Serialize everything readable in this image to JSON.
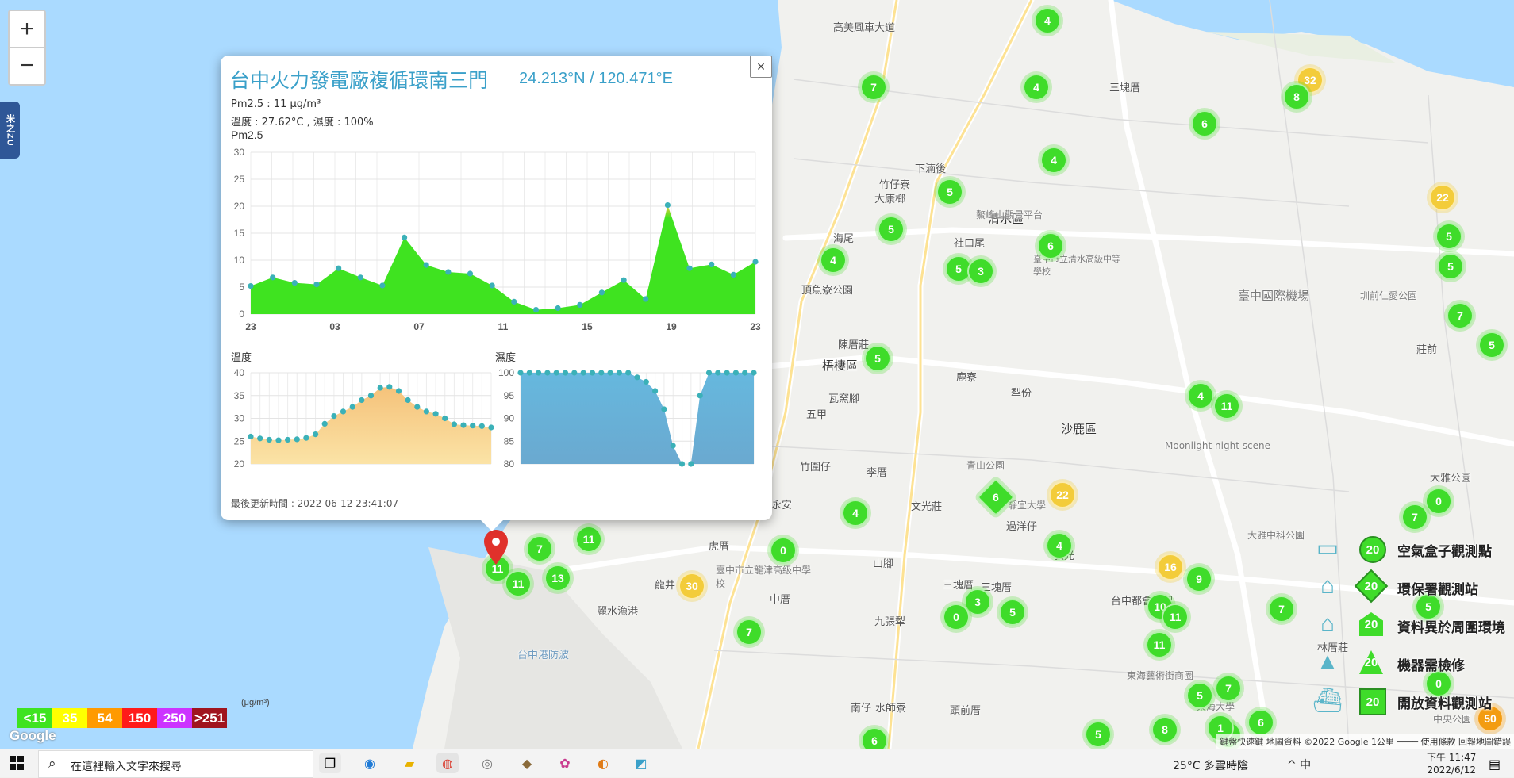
{
  "zoom": {
    "in_label": "+",
    "out_label": "−"
  },
  "side_tab": {
    "label": "米之ZU"
  },
  "popup": {
    "title": "台中火力發電廠複循環南三門",
    "coords": "24.213°N / 120.471°E",
    "pm_line": "Pm2.5 : 11 μg/m³",
    "temp_hum_line": "溫度 : 27.62°C , 濕度 : 100%",
    "chart_title": "Pm2.5",
    "temp_title": "溫度",
    "hum_title": "濕度",
    "updated": "最後更新時間 : 2022-06-12 23:41:07",
    "close_label": "×"
  },
  "chart_data": [
    {
      "type": "area",
      "title": "Pm2.5",
      "x": [
        "23",
        "00",
        "01",
        "02",
        "03",
        "04",
        "05",
        "06",
        "07",
        "08",
        "09",
        "10",
        "11",
        "12",
        "13",
        "14",
        "15",
        "16",
        "17",
        "18",
        "19",
        "20",
        "21",
        "22",
        "23"
      ],
      "xticks": [
        "23",
        "03",
        "07",
        "11",
        "15",
        "19",
        "23"
      ],
      "values": [
        5.2,
        6.8,
        5.8,
        5.5,
        8.5,
        6.8,
        5.3,
        14.2,
        9.1,
        7.8,
        7.5,
        5.3,
        2.3,
        0.8,
        1.1,
        1.7,
        4.0,
        6.3,
        2.8,
        20.2,
        8.5,
        9.2,
        7.3,
        9.7
      ],
      "ylim": [
        0,
        30
      ],
      "yticks": [
        0,
        5,
        10,
        15,
        20,
        25,
        30
      ],
      "color": "#3fe320",
      "peak_color": "#f3cc3a"
    },
    {
      "type": "area",
      "title": "溫度",
      "values": [
        26.0,
        25.6,
        25.3,
        25.2,
        25.3,
        25.4,
        25.7,
        26.5,
        28.8,
        30.5,
        31.5,
        32.5,
        34.0,
        35.0,
        36.7,
        36.9,
        36.0,
        34.0,
        32.5,
        31.5,
        31.0,
        30.0,
        28.7,
        28.5,
        28.4,
        28.3,
        28.0
      ],
      "ylim": [
        20,
        40
      ],
      "yticks": [
        20,
        25,
        30,
        35,
        40
      ],
      "color": "#f5c27a"
    },
    {
      "type": "area",
      "title": "濕度",
      "values": [
        100,
        100,
        100,
        100,
        100,
        100,
        100,
        100,
        100,
        100,
        100,
        100,
        100,
        99,
        98,
        96,
        92,
        84,
        80,
        80,
        95,
        100,
        100,
        100,
        100,
        100,
        100
      ],
      "ylim": [
        80,
        100
      ],
      "yticks": [
        80,
        85,
        90,
        95,
        100
      ],
      "color": "#66b8de"
    }
  ],
  "scale_legend": {
    "unit": "(μg/m³)",
    "bins": [
      {
        "label": "<15",
        "color": "#3fe320"
      },
      {
        "label": "35",
        "color": "#ffff00"
      },
      {
        "label": "54",
        "color": "#ff9a00"
      },
      {
        "label": "150",
        "color": "#ff1a1a"
      },
      {
        "label": "250",
        "color": "#cc33ff"
      },
      {
        "label": ">251",
        "color": "#a0141e"
      }
    ]
  },
  "station_legend": [
    {
      "badge": "20",
      "label": "空氣盒子觀測點"
    },
    {
      "badge": "20",
      "label": "環保署觀測站"
    },
    {
      "badge": "20",
      "label": "資料異於周圍環境"
    },
    {
      "badge": "20",
      "label": "機器需檢修"
    },
    {
      "badge": "20",
      "label": "開放資料觀測站"
    }
  ],
  "google_logo": "Google",
  "attribution": "鍵盤快速鍵  地圖資料 ©2022 Google  1公里 ━━━━  使用條款  回報地圖錯誤",
  "places": [
    {
      "label": "清水區"
    },
    {
      "label": "梧棲區"
    },
    {
      "label": "沙鹿區"
    },
    {
      "label": "龍井"
    },
    {
      "label": "臺中國際機場"
    },
    {
      "label": "高美風車大道"
    },
    {
      "label": "海尾"
    },
    {
      "label": "大康榔"
    },
    {
      "label": "竹仔寮"
    },
    {
      "label": "下湳後"
    },
    {
      "label": "社口尾"
    },
    {
      "label": "頂魚寮公園"
    },
    {
      "label": "瓦窯腳"
    },
    {
      "label": "五甲"
    },
    {
      "label": "陳厝莊"
    },
    {
      "label": "鹿寮"
    },
    {
      "label": "犁份"
    },
    {
      "label": "竹圍仔"
    },
    {
      "label": "李厝"
    },
    {
      "label": "文光莊"
    },
    {
      "label": "青山公園"
    },
    {
      "label": "靜宜大學"
    },
    {
      "label": "過洋仔"
    },
    {
      "label": "山腳"
    },
    {
      "label": "九張犁"
    },
    {
      "label": "三塊厝"
    },
    {
      "label": "麗水漁港"
    },
    {
      "label": "臺中市立龍津高級中學校"
    },
    {
      "label": "虎厝"
    },
    {
      "label": "南仔"
    },
    {
      "label": "水師寮"
    },
    {
      "label": "頭前厝"
    },
    {
      "label": "台中都會公園"
    },
    {
      "label": "大雅中科公園"
    },
    {
      "label": "Moonlight night scene"
    },
    {
      "label": "東海藝術街商圈"
    },
    {
      "label": "東海大學"
    },
    {
      "label": "林厝莊"
    },
    {
      "label": "圳前仁愛公園"
    },
    {
      "label": "莊前"
    },
    {
      "label": "大雅公園"
    },
    {
      "label": "永安"
    },
    {
      "label": "鰲峰山觀景平台"
    },
    {
      "label": "臺中市立清水高級中等學校"
    },
    {
      "label": "三塊厝"
    },
    {
      "label": "中央公園"
    },
    {
      "label": "三塊厝"
    },
    {
      "label": "弘光"
    },
    {
      "label": "中厝"
    },
    {
      "label": "台中港防波"
    }
  ],
  "markers": [
    {
      "v": "4"
    },
    {
      "v": "7"
    },
    {
      "v": "4"
    },
    {
      "v": "6"
    },
    {
      "v": "32"
    },
    {
      "v": "8"
    },
    {
      "v": "4"
    },
    {
      "v": "5"
    },
    {
      "v": "5"
    },
    {
      "v": "4"
    },
    {
      "v": "6"
    },
    {
      "v": "5"
    },
    {
      "v": "3"
    },
    {
      "v": "22"
    },
    {
      "v": "5"
    },
    {
      "v": "5"
    },
    {
      "v": "7"
    },
    {
      "v": "5"
    },
    {
      "v": "5"
    },
    {
      "v": "4"
    },
    {
      "v": "11"
    },
    {
      "v": "6"
    },
    {
      "v": "22"
    },
    {
      "v": "4"
    },
    {
      "v": "4"
    },
    {
      "v": "0"
    },
    {
      "v": "7"
    },
    {
      "v": "11"
    },
    {
      "v": "7"
    },
    {
      "v": "11"
    },
    {
      "v": "11"
    },
    {
      "v": "13"
    },
    {
      "v": "0"
    },
    {
      "v": "30"
    },
    {
      "v": "7"
    },
    {
      "v": "16"
    },
    {
      "v": "9"
    },
    {
      "v": "10"
    },
    {
      "v": "11"
    },
    {
      "v": "3"
    },
    {
      "v": "5"
    },
    {
      "v": "0"
    },
    {
      "v": "7"
    },
    {
      "v": "5"
    },
    {
      "v": "11"
    },
    {
      "v": "7"
    },
    {
      "v": "5"
    },
    {
      "v": "7"
    },
    {
      "v": "8"
    },
    {
      "v": "1"
    },
    {
      "v": "6"
    },
    {
      "v": "5"
    },
    {
      "v": "6"
    },
    {
      "v": "50"
    },
    {
      "v": "0"
    }
  ],
  "taskbar": {
    "search_placeholder": "在這裡輸入文字來搜尋",
    "weather": "25°C  多雲時陰",
    "tray": "^  中",
    "time": "下午 11:47",
    "date": "2022/6/12"
  }
}
